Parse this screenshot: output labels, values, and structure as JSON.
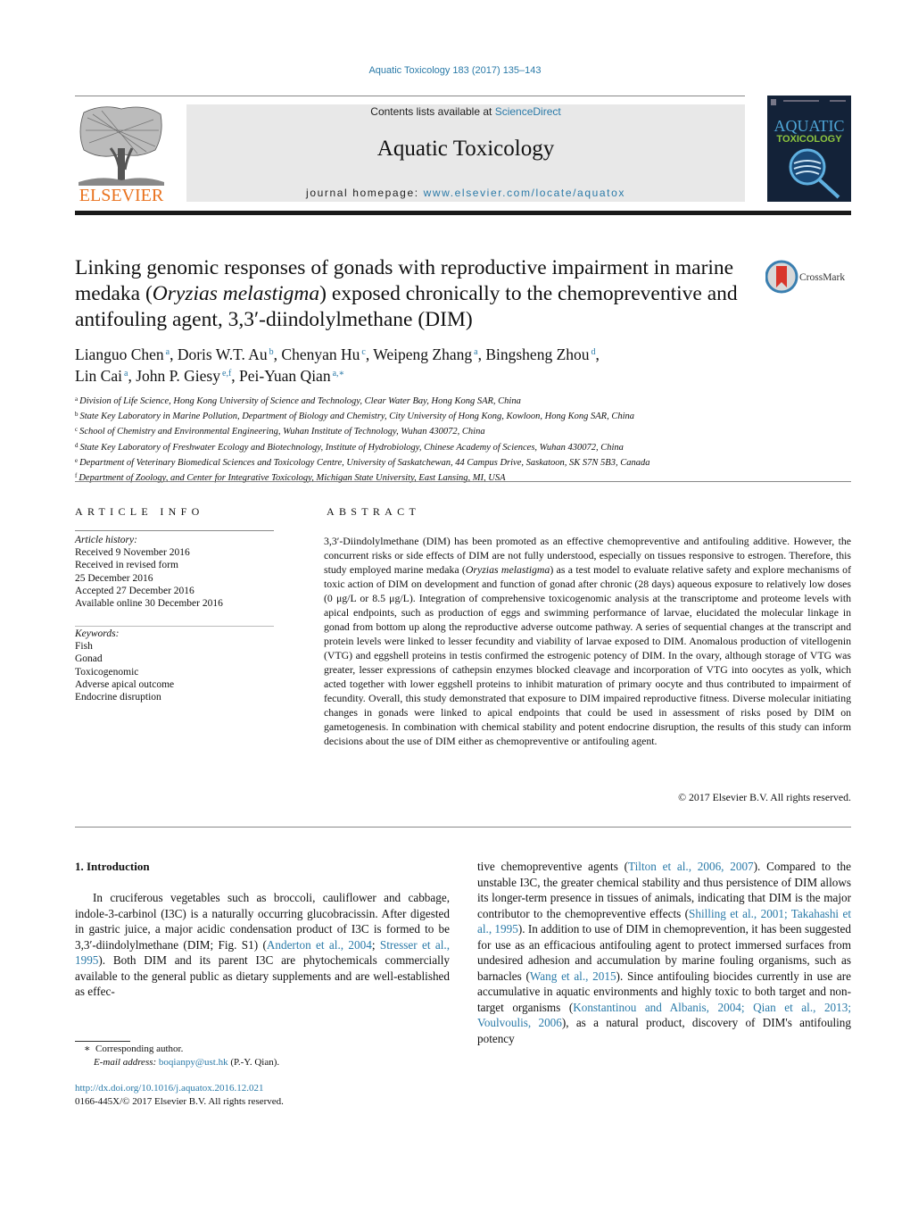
{
  "header": {
    "journal_ref": "Aquatic Toxicology 183 (2017) 135–143",
    "contents_prefix": "Contents lists available at ",
    "contents_link": "ScienceDirect",
    "journal_name": "Aquatic Toxicology",
    "homepage_prefix": "journal homepage: ",
    "homepage_link": "www.elsevier.com/locate/aquatox",
    "publisher_logo_text": "ELSEVIER",
    "cover_title_1": "AQUATIC",
    "cover_title_2": "TOXICOLOGY",
    "crossmark_label": "CrossMark"
  },
  "article": {
    "title_part1": "Linking genomic responses of gonads with reproductive impairment in marine medaka (",
    "title_italic": "Oryzias melastigma",
    "title_part2": ") exposed chronically to the chemopreventive and antifouling agent, 3,3′-diindolylmethane (DIM)",
    "authors": [
      {
        "name": "Lianguo Chen",
        "aff": "a",
        "sep": ", "
      },
      {
        "name": "Doris W.T. Au",
        "aff": "b",
        "sep": ", "
      },
      {
        "name": "Chenyan Hu",
        "aff": "c",
        "sep": ", "
      },
      {
        "name": "Weipeng Zhang",
        "aff": "a",
        "sep": ", "
      },
      {
        "name": "Bingsheng Zhou",
        "aff": "d",
        "sep": ","
      },
      {
        "name": "Lin Cai",
        "aff": "a",
        "sep": ", "
      },
      {
        "name": "John P. Giesy",
        "aff": "e,f",
        "sep": ", "
      },
      {
        "name": "Pei-Yuan Qian",
        "aff": "a,∗",
        "sep": ""
      }
    ],
    "affiliations": [
      {
        "key": "a",
        "text": "Division of Life Science, Hong Kong University of Science and Technology, Clear Water Bay, Hong Kong SAR, China"
      },
      {
        "key": "b",
        "text": "State Key Laboratory in Marine Pollution, Department of Biology and Chemistry, City University of Hong Kong, Kowloon, Hong Kong SAR, China"
      },
      {
        "key": "c",
        "text": "School of Chemistry and Environmental Engineering, Wuhan Institute of Technology, Wuhan 430072, China"
      },
      {
        "key": "d",
        "text": "State Key Laboratory of Freshwater Ecology and Biotechnology, Institute of Hydrobiology, Chinese Academy of Sciences, Wuhan 430072, China"
      },
      {
        "key": "e",
        "text": "Department of Veterinary Biomedical Sciences and Toxicology Centre, University of Saskatchewan, 44 Campus Drive, Saskatoon, SK S7N 5B3, Canada"
      },
      {
        "key": "f",
        "text": "Department of Zoology, and Center for Integrative Toxicology, Michigan State University, East Lansing, MI, USA"
      }
    ]
  },
  "article_info": {
    "label": "ARTICLE INFO",
    "history_label": "Article history:",
    "history": [
      "Received 9 November 2016",
      "Received in revised form",
      "25 December 2016",
      "Accepted 27 December 2016",
      "Available online 30 December 2016"
    ],
    "keywords_label": "Keywords:",
    "keywords": [
      "Fish",
      "Gonad",
      "Toxicogenomic",
      "Adverse apical outcome",
      "Endocrine disruption"
    ]
  },
  "abstract": {
    "label": "ABSTRACT",
    "text_before_italic": "3,3′-Diindolylmethane (DIM) has been promoted as an effective chemopreventive and antifouling additive. However, the concurrent risks or side effects of DIM are not fully understood, especially on tissues responsive to estrogen. Therefore, this study employed marine medaka (",
    "italic": "Oryzias melastigma",
    "text_after_italic": ") as a test model to evaluate relative safety and explore mechanisms of toxic action of DIM on development and function of gonad after chronic (28 days) aqueous exposure to relatively low doses (0 μg/L or 8.5 μg/L). Integration of comprehensive toxicogenomic analysis at the transcriptome and proteome levels with apical endpoints, such as production of eggs and swimming performance of larvae, elucidated the molecular linkage in gonad from bottom up along the reproductive adverse outcome pathway. A series of sequential changes at the transcript and protein levels were linked to lesser fecundity and viability of larvae exposed to DIM. Anomalous production of vitellogenin (VTG) and eggshell proteins in testis confirmed the estrogenic potency of DIM. In the ovary, although storage of VTG was greater, lesser expressions of cathepsin enzymes blocked cleavage and incorporation of VTG into oocytes as yolk, which acted together with lower eggshell proteins to inhibit maturation of primary oocyte and thus contributed to impairment of fecundity. Overall, this study demonstrated that exposure to DIM impaired reproductive fitness. Diverse molecular initiating changes in gonads were linked to apical endpoints that could be used in assessment of risks posed by DIM on gametogenesis. In combination with chemical stability and potent endocrine disruption, the results of this study can inform decisions about the use of DIM either as chemopreventive or antifouling agent.",
    "copyright": "© 2017 Elsevier B.V. All rights reserved."
  },
  "introduction": {
    "heading": "1.  Introduction",
    "col1": [
      {
        "t": "In cruciferous vegetables such as broccoli, cauliflower and cabbage, indole-3-carbinol (I3C) is a naturally occurring glucobracissin. After digested in gastric juice, a major acidic condensation product of I3C is formed to be 3,3′-diindolylmethane (DIM; Fig. S1) ("
      },
      {
        "link": "Anderton et al., 2004"
      },
      {
        "t": "; "
      },
      {
        "link": "Stresser et al., 1995"
      },
      {
        "t": "). Both DIM and its parent I3C are phytochemicals commercially available to the general public as dietary supplements and are well-established as effec-"
      }
    ],
    "col2": [
      {
        "t": "tive chemopreventive agents ("
      },
      {
        "link": "Tilton et al., 2006, 2007"
      },
      {
        "t": "). Compared to the unstable I3C, the greater chemical stability and thus persistence of DIM allows its longer-term presence in tissues of animals, indicating that DIM is the major contributor to the chemopreventive effects ("
      },
      {
        "link": "Shilling et al., 2001; Takahashi et al., 1995"
      },
      {
        "t": "). In addition to use of DIM in chemoprevention, it has been suggested for use as an efficacious antifouling agent to protect immersed surfaces from undesired adhesion and accumulation by marine fouling organisms, such as barnacles ("
      },
      {
        "link": "Wang et al., 2015"
      },
      {
        "t": "). Since antifouling biocides currently in use are accumulative in aquatic environments and highly toxic to both target and non-target organisms ("
      },
      {
        "link": "Konstantinou and Albanis, 2004; Qian et al., 2013; Voulvoulis, 2006"
      },
      {
        "t": "), as a natural product, discovery of DIM's antifouling potency"
      }
    ]
  },
  "footer": {
    "corresponding_mark": "∗",
    "corresponding_text": "Corresponding author.",
    "email_label": "E-mail address: ",
    "email": "boqianpy@ust.hk",
    "email_suffix": " (P.-Y. Qian).",
    "doi": "http://dx.doi.org/10.1016/j.aquatox.2016.12.021",
    "issn_copyright": "0166-445X/© 2017 Elsevier B.V. All rights reserved."
  },
  "colors": {
    "link": "#2a7aa8",
    "elsevier_orange": "#e9711c",
    "cover_bg": "#132238",
    "cover_green": "#8dc63f",
    "header_box": "#e8e8e8"
  }
}
